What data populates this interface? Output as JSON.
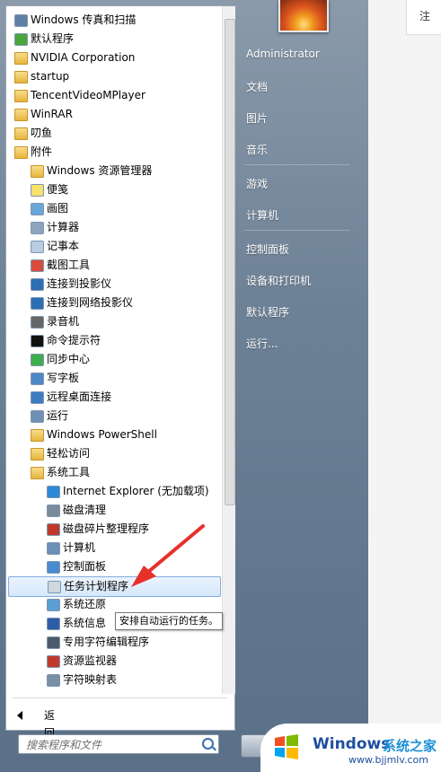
{
  "background": {
    "cut_label": "注"
  },
  "programs": [
    {
      "label": "Windows 传真和扫描",
      "kind": "app",
      "color": "#5f7fa5"
    },
    {
      "label": "默认程序",
      "kind": "app",
      "color": "#4aa63c"
    },
    {
      "label": "NVIDIA Corporation",
      "kind": "folder"
    },
    {
      "label": "startup",
      "kind": "folder"
    },
    {
      "label": "TencentVideoMPlayer",
      "kind": "folder"
    },
    {
      "label": "WinRAR",
      "kind": "folder"
    },
    {
      "label": "叨鱼",
      "kind": "folder"
    },
    {
      "label": "附件",
      "kind": "folder"
    },
    {
      "label": "Windows 资源管理器",
      "kind": "folder"
    },
    {
      "label": "便笺",
      "kind": "app",
      "color": "#f4e26b"
    },
    {
      "label": "画图",
      "kind": "app",
      "color": "#6aa6d8"
    },
    {
      "label": "计算器",
      "kind": "app",
      "color": "#8ea4bd"
    },
    {
      "label": "记事本",
      "kind": "app",
      "color": "#b8cde0"
    },
    {
      "label": "截图工具",
      "kind": "app",
      "color": "#d94c3d"
    },
    {
      "label": "连接到投影仪",
      "kind": "app",
      "color": "#2c6fb3"
    },
    {
      "label": "连接到网络投影仪",
      "kind": "app",
      "color": "#2c6fb3"
    },
    {
      "label": "录音机",
      "kind": "app",
      "color": "#666666"
    },
    {
      "label": "命令提示符",
      "kind": "app",
      "color": "#111111"
    },
    {
      "label": "同步中心",
      "kind": "app",
      "color": "#3bb04a"
    },
    {
      "label": "写字板",
      "kind": "app",
      "color": "#4f86c6"
    },
    {
      "label": "远程桌面连接",
      "kind": "app",
      "color": "#3e7cc2"
    },
    {
      "label": "运行",
      "kind": "app",
      "color": "#6f8fb3"
    },
    {
      "label": "Windows PowerShell",
      "kind": "folder"
    },
    {
      "label": "轻松访问",
      "kind": "folder"
    },
    {
      "label": "系统工具",
      "kind": "folder"
    },
    {
      "label": "Internet Explorer (无加载项)",
      "kind": "app",
      "color": "#2a8ad8"
    },
    {
      "label": "磁盘清理",
      "kind": "app",
      "color": "#7a8b9a"
    },
    {
      "label": "磁盘碎片整理程序",
      "kind": "app",
      "color": "#c0392b"
    },
    {
      "label": "计算机",
      "kind": "app",
      "color": "#6d8fb5"
    },
    {
      "label": "控制面板",
      "kind": "app",
      "color": "#4a8bcf"
    },
    {
      "label": "任务计划程序",
      "kind": "app",
      "color": "#cfd8e0",
      "selected": true
    },
    {
      "label": "系统还原",
      "kind": "app",
      "color": "#5aa0d6"
    },
    {
      "label": "系统信息",
      "kind": "app",
      "color": "#2d5da8"
    },
    {
      "label": "专用字符编辑程序",
      "kind": "app",
      "color": "#4b5b6b"
    },
    {
      "label": "资源监视器",
      "kind": "app",
      "color": "#c0392b"
    },
    {
      "label": "字符映射表",
      "kind": "app",
      "color": "#7a8fa8"
    }
  ],
  "tooltip": "安排自动运行的任务。",
  "back_label": "返回",
  "search": {
    "placeholder": "搜索程序和文件"
  },
  "right_pane": {
    "items": [
      "Administrator",
      "文档",
      "图片",
      "音乐",
      "游戏",
      "计算机",
      "控制面板",
      "设备和打印机",
      "默认程序",
      "运行..."
    ]
  },
  "watermark": {
    "brand": "Windows",
    "brand2": "系统之家",
    "url": "www.bjjmlv.com"
  }
}
